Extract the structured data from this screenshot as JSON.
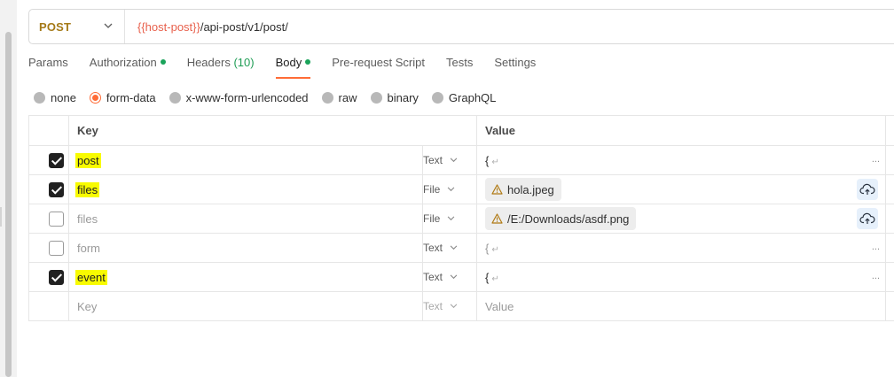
{
  "request": {
    "method": "POST",
    "url_variable": "{{host-post}}",
    "url_path": "/api-post/v1/post/"
  },
  "tabs": [
    {
      "label": "Params"
    },
    {
      "label": "Authorization",
      "dot": true
    },
    {
      "label": "Headers",
      "count": "(10)"
    },
    {
      "label": "Body",
      "dot": true,
      "active": true
    },
    {
      "label": "Pre-request Script"
    },
    {
      "label": "Tests"
    },
    {
      "label": "Settings"
    }
  ],
  "body_types": [
    {
      "label": "none",
      "selected": false
    },
    {
      "label": "form-data",
      "selected": true
    },
    {
      "label": "x-www-form-urlencoded",
      "selected": false
    },
    {
      "label": "raw",
      "selected": false
    },
    {
      "label": "binary",
      "selected": false
    },
    {
      "label": "GraphQL",
      "selected": false
    }
  ],
  "table": {
    "headers": {
      "key": "Key",
      "value": "Value"
    },
    "rows": [
      {
        "checked": true,
        "key": "post",
        "highlight": true,
        "type": "Text",
        "value": "{",
        "more": "..."
      },
      {
        "checked": true,
        "key": "files",
        "highlight": true,
        "type": "File",
        "file": "hola.jpeg"
      },
      {
        "checked": false,
        "key": "files",
        "highlight": false,
        "type": "File",
        "file": "/E:/Downloads/asdf.png"
      },
      {
        "checked": false,
        "key": "form",
        "highlight": false,
        "type": "Text",
        "value": "{",
        "more": "..."
      },
      {
        "checked": true,
        "key": "event",
        "highlight": true,
        "type": "Text",
        "value": "{",
        "more": "..."
      }
    ],
    "new_row": {
      "key_placeholder": "Key",
      "type": "Text",
      "value_placeholder": "Value"
    }
  },
  "icons": {
    "chevron": "chevron-down-icon",
    "warning": "warning-triangle-icon",
    "upload": "cloud-upload-icon",
    "return": "return-arrow-icon"
  },
  "colors": {
    "accent": "#ff6c37",
    "method": "#a57a18",
    "variable": "#e8614d",
    "status_dot": "#1aa35a",
    "highlight": "#f8fb00"
  }
}
